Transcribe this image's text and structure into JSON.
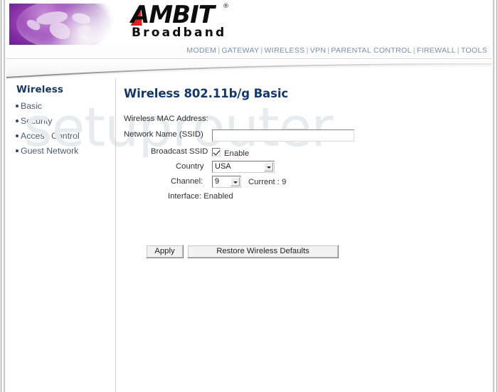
{
  "brand": {
    "name": "AMBIT",
    "tagline": "Broadband",
    "registered_mark": "®",
    "globe_alt": "globe-graphic"
  },
  "nav": {
    "separator": "|",
    "items": [
      {
        "label": "MODEM"
      },
      {
        "label": "GATEWAY"
      },
      {
        "label": "WIRELESS"
      },
      {
        "label": "VPN"
      },
      {
        "label": "PARENTAL CONTROL"
      },
      {
        "label": "FIREWALL"
      },
      {
        "label": "TOOLS"
      }
    ]
  },
  "sidebar": {
    "title": "Wireless",
    "items": [
      {
        "label": "Basic"
      },
      {
        "label": "Security"
      },
      {
        "label": "Access Control"
      },
      {
        "label": "Guest Network"
      }
    ]
  },
  "watermark": {
    "text": "setuprouter"
  },
  "main": {
    "title": "Wireless 802.11b/g Basic",
    "fields": {
      "mac_label": "Wireless MAC Address:",
      "mac_value": "",
      "ssid_label": "Network Name (SSID)",
      "ssid_value": "",
      "ssid_placeholder": "",
      "broadcast_label": "Broadcast SSID",
      "broadcast_enable_label": "Enable",
      "broadcast_checked": true,
      "country_label": "Country",
      "country_value": "USA",
      "country_options": [
        "USA"
      ],
      "channel_label": "Channel:",
      "channel_value": "9",
      "channel_options": [
        "9"
      ],
      "channel_current": "Current : 9",
      "interface_label": "Interface: Enabled"
    },
    "buttons": {
      "apply": "Apply",
      "restore": "Restore Wireless Defaults"
    }
  },
  "colors": {
    "heading": "#15386c",
    "nav_text": "#7b8fa8",
    "sidebar_link": "#4c5c70",
    "brand_red": "#e02020",
    "globe_purple": "#7b2a9e",
    "watermark": "#e8eaee"
  }
}
